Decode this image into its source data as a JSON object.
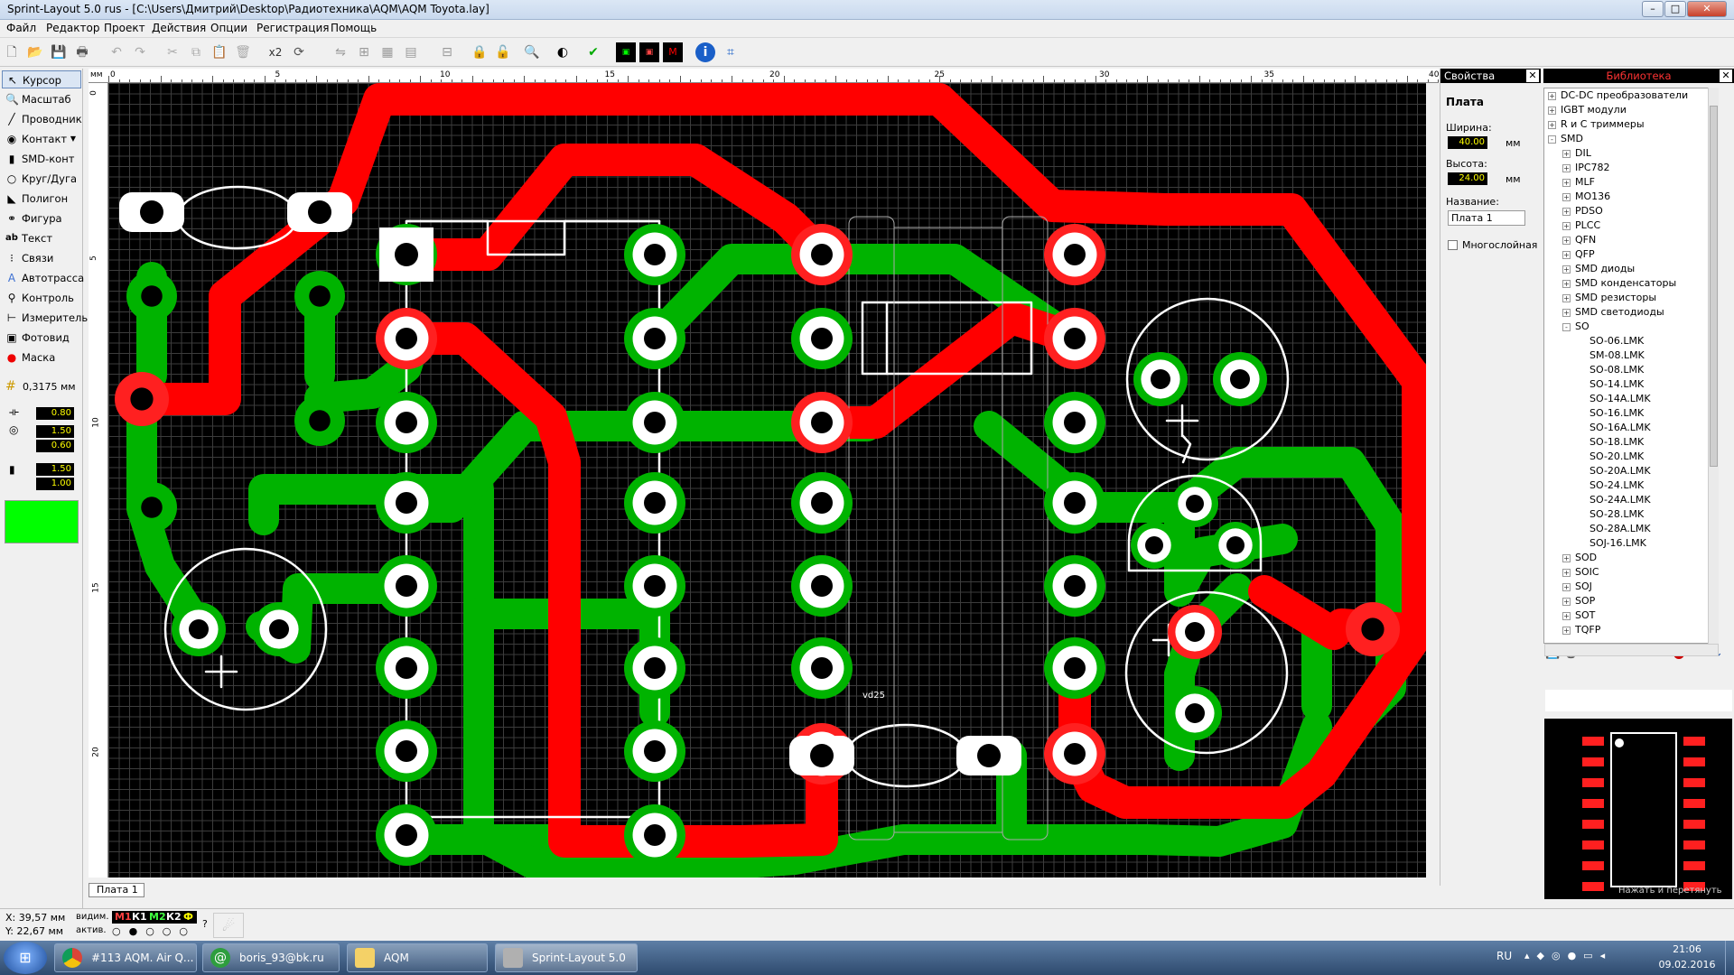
{
  "window": {
    "title": "Sprint-Layout 5.0 rus  -  [C:\\Users\\Дмитрий\\Desktop\\Радиотехника\\AQM\\AQM Toyota.lay]"
  },
  "menu": [
    "Файл",
    "Редактор",
    "Проект",
    "Действия",
    "Опции",
    "Регистрация",
    "Помощь"
  ],
  "toolbar": {
    "zoom2": "x2"
  },
  "tools": [
    {
      "label": "Курсор",
      "icon": "cursor-icon"
    },
    {
      "label": "Масштаб",
      "icon": "zoom-icon"
    },
    {
      "label": "Проводник",
      "icon": "track-icon"
    },
    {
      "label": "Контакт",
      "icon": "pad-icon"
    },
    {
      "label": "SMD-конт",
      "icon": "smd-pad-icon"
    },
    {
      "label": "Круг/Дуга",
      "icon": "circle-icon"
    },
    {
      "label": "Полигон",
      "icon": "polygon-icon"
    },
    {
      "label": "Фигура",
      "icon": "shape-icon"
    },
    {
      "label": "Текст",
      "icon": "text-icon"
    },
    {
      "label": "Связи",
      "icon": "connections-icon"
    },
    {
      "label": "Автотрасса",
      "icon": "autoroute-icon"
    },
    {
      "label": "Контроль",
      "icon": "check-icon"
    },
    {
      "label": "Измеритель",
      "icon": "measure-icon"
    },
    {
      "label": "Фотовид",
      "icon": "photo-icon"
    },
    {
      "label": "Маска",
      "icon": "mask-icon"
    }
  ],
  "grid": {
    "label": "0,3175 мм"
  },
  "track_values": [
    "0.80",
    "1.50",
    "0.60",
    "1.50",
    "1.00"
  ],
  "active_color": "#00ff00",
  "ruler": {
    "unit": "мм",
    "top_ticks": [
      "0",
      "5",
      "10",
      "15",
      "20",
      "25",
      "30",
      "35",
      "40"
    ],
    "left_ticks": [
      "0",
      "5",
      "10",
      "15",
      "20"
    ]
  },
  "board_tab": "Плата 1",
  "properties": {
    "header": "Свойства",
    "section": "Плата",
    "width_label": "Ширина:",
    "width_value": "40.00",
    "height_label": "Высота:",
    "height_value": "24.00",
    "unit": "мм",
    "name_label": "Название:",
    "name_value": "Плата 1",
    "multilayer_label": "Многослойная"
  },
  "library": {
    "header": "Библиотека",
    "tree": [
      {
        "label": "DC-DC преобразователи",
        "level": 0,
        "exp": "+"
      },
      {
        "label": "IGBT модули",
        "level": 0,
        "exp": "+"
      },
      {
        "label": "R и C триммеры",
        "level": 0,
        "exp": "+"
      },
      {
        "label": "SMD",
        "level": 0,
        "exp": "-"
      },
      {
        "label": "DIL",
        "level": 1,
        "exp": "+"
      },
      {
        "label": "IPC782",
        "level": 1,
        "exp": "+"
      },
      {
        "label": "MLF",
        "level": 1,
        "exp": "+"
      },
      {
        "label": "MO136",
        "level": 1,
        "exp": "+"
      },
      {
        "label": "PDSO",
        "level": 1,
        "exp": "+"
      },
      {
        "label": "PLCC",
        "level": 1,
        "exp": "+"
      },
      {
        "label": "QFN",
        "level": 1,
        "exp": "+"
      },
      {
        "label": "QFP",
        "level": 1,
        "exp": "+"
      },
      {
        "label": "SMD диоды",
        "level": 1,
        "exp": "+"
      },
      {
        "label": "SMD конденсаторы",
        "level": 1,
        "exp": "+"
      },
      {
        "label": "SMD резисторы",
        "level": 1,
        "exp": "+"
      },
      {
        "label": "SMD светодиоды",
        "level": 1,
        "exp": "+"
      },
      {
        "label": "SO",
        "level": 1,
        "exp": "-"
      },
      {
        "label": "SO-06.LMK",
        "level": 2,
        "exp": ""
      },
      {
        "label": "SM-08.LMK",
        "level": 2,
        "exp": ""
      },
      {
        "label": "SO-08.LMK",
        "level": 2,
        "exp": ""
      },
      {
        "label": "SO-14.LMK",
        "level": 2,
        "exp": ""
      },
      {
        "label": "SO-14A.LMK",
        "level": 2,
        "exp": ""
      },
      {
        "label": "SO-16.LMK",
        "level": 2,
        "exp": ""
      },
      {
        "label": "SO-16A.LMK",
        "level": 2,
        "exp": ""
      },
      {
        "label": "SO-18.LMK",
        "level": 2,
        "exp": ""
      },
      {
        "label": "SO-20.LMK",
        "level": 2,
        "exp": ""
      },
      {
        "label": "SO-20A.LMK",
        "level": 2,
        "exp": ""
      },
      {
        "label": "SO-24.LMK",
        "level": 2,
        "exp": ""
      },
      {
        "label": "SO-24A.LMK",
        "level": 2,
        "exp": ""
      },
      {
        "label": "SO-28.LMK",
        "level": 2,
        "exp": ""
      },
      {
        "label": "SO-28A.LMK",
        "level": 2,
        "exp": ""
      },
      {
        "label": "SOJ-16.LMK",
        "level": 2,
        "exp": ""
      },
      {
        "label": "SOD",
        "level": 1,
        "exp": "+"
      },
      {
        "label": "SOIC",
        "level": 1,
        "exp": "+"
      },
      {
        "label": "SOJ",
        "level": 1,
        "exp": "+"
      },
      {
        "label": "SOP",
        "level": 1,
        "exp": "+"
      },
      {
        "label": "SOT",
        "level": 1,
        "exp": "+"
      },
      {
        "label": "TQFP",
        "level": 1,
        "exp": "+"
      }
    ],
    "drag_hint": "Нажать и перетянуть"
  },
  "silk_label": "vd25",
  "status": {
    "x": "X:  39,57 мм",
    "y": "Y:  22,67 мм",
    "visible_label": "видим.",
    "active_label": "актив.",
    "layers": [
      {
        "name": "М1",
        "color": "#ff4040"
      },
      {
        "name": "К1",
        "color": "#ffffff"
      },
      {
        "name": "М2",
        "color": "#40ff40"
      },
      {
        "name": "К2",
        "color": "#ffffff"
      },
      {
        "name": "Ф",
        "color": "#ffff00"
      }
    ]
  },
  "taskbar": {
    "items": [
      {
        "label": "#113 AQM. Air Q...",
        "icon": "chrome-icon"
      },
      {
        "label": "boris_93@bk.ru",
        "icon": "mail-icon"
      },
      {
        "label": "AQM",
        "icon": "folder-icon"
      },
      {
        "label": "Sprint-Layout 5.0",
        "icon": "sprint-layout-icon"
      }
    ],
    "lang": "RU",
    "time": "21:06",
    "date": "09.02.2016"
  }
}
